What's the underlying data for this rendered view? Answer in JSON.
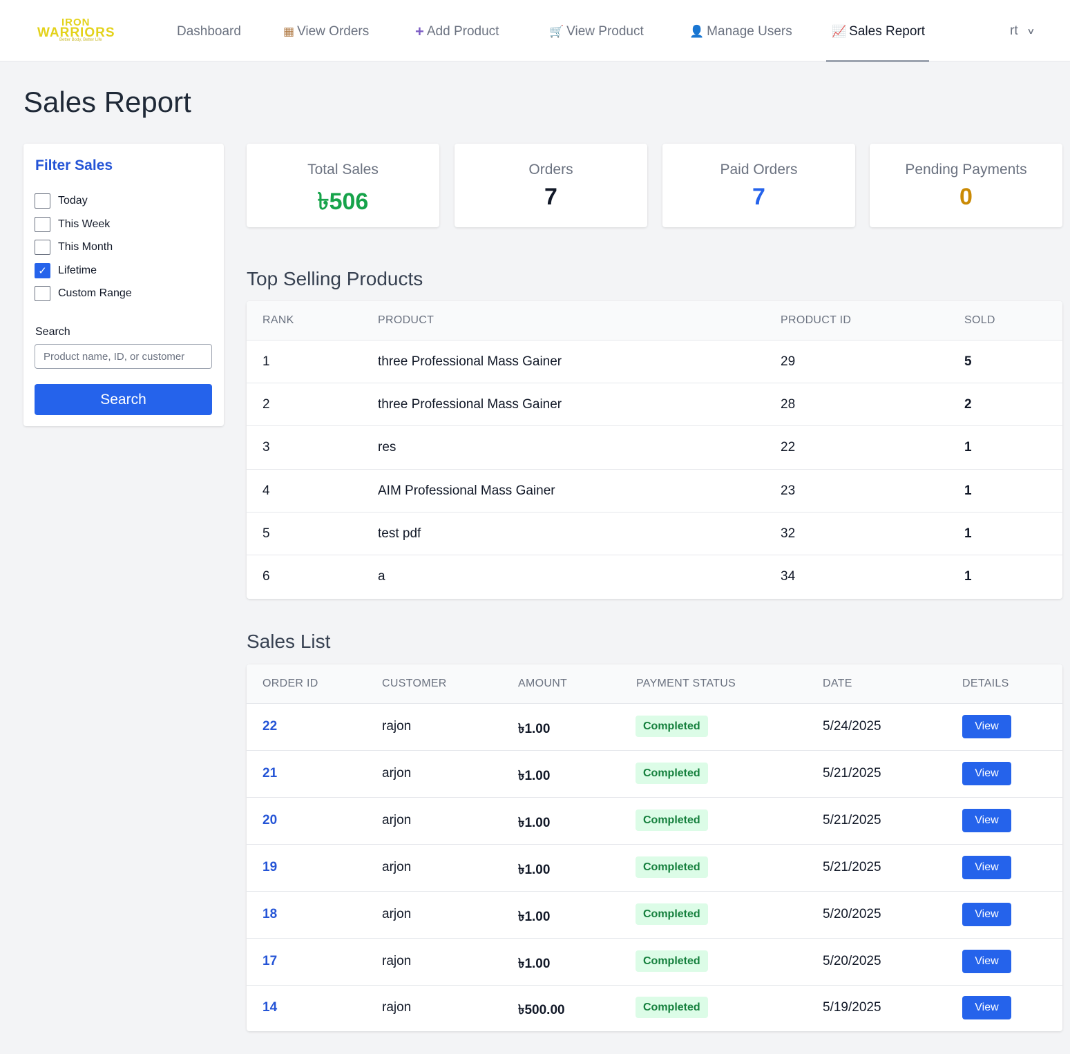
{
  "colors": {
    "accent": "#2563eb",
    "title_blue": "#2454d6",
    "sales_green": "#16a34a",
    "paid_blue": "#2563eb",
    "pending_amber": "#ca8a04",
    "badge_bg": "#dcfce7",
    "badge_text": "#15803d"
  },
  "logo": {
    "line1": "IRON",
    "line2": "WARRIORS",
    "tagline": "Better Body, Better Life"
  },
  "nav": {
    "items": [
      {
        "label": "Dashboard",
        "icon": ""
      },
      {
        "label": "View Orders",
        "icon": "package-icon"
      },
      {
        "label": "Add Product",
        "icon": "plus-icon"
      },
      {
        "label": "View Product",
        "icon": "cart-icon"
      },
      {
        "label": "Manage Users",
        "icon": "user-icon"
      },
      {
        "label": "Sales Report",
        "icon": "chart-icon"
      }
    ],
    "user": "rt"
  },
  "page_title": "Sales Report",
  "filter": {
    "title": "Filter Sales",
    "options": [
      {
        "label": "Today",
        "checked": false
      },
      {
        "label": "This Week",
        "checked": false
      },
      {
        "label": "This Month",
        "checked": false
      },
      {
        "label": "Lifetime",
        "checked": true
      },
      {
        "label": "Custom Range",
        "checked": false
      }
    ],
    "search_label": "Search",
    "search_placeholder": "Product name, ID, or customer",
    "search_button": "Search"
  },
  "stats": [
    {
      "label": "Total Sales",
      "value": "৳506"
    },
    {
      "label": "Orders",
      "value": "7"
    },
    {
      "label": "Paid Orders",
      "value": "7"
    },
    {
      "label": "Pending Payments",
      "value": "0"
    }
  ],
  "top_products": {
    "title": "Top Selling Products",
    "headers": [
      "RANK",
      "PRODUCT",
      "PRODUCT ID",
      "SOLD"
    ],
    "rows": [
      [
        "1",
        "three Professional Mass Gainer",
        "29",
        "5"
      ],
      [
        "2",
        "three Professional Mass Gainer",
        "28",
        "2"
      ],
      [
        "3",
        "res",
        "22",
        "1"
      ],
      [
        "4",
        "AIM Professional Mass Gainer",
        "23",
        "1"
      ],
      [
        "5",
        "test pdf",
        "32",
        "1"
      ],
      [
        "6",
        "a",
        "34",
        "1"
      ]
    ]
  },
  "sales_list": {
    "title": "Sales List",
    "headers": [
      "ORDER ID",
      "CUSTOMER",
      "AMOUNT",
      "PAYMENT STATUS",
      "DATE",
      "DETAILS"
    ],
    "view_label": "View",
    "rows": [
      [
        "22",
        "rajon",
        "৳1.00",
        "Completed",
        "5/24/2025"
      ],
      [
        "21",
        "arjon",
        "৳1.00",
        "Completed",
        "5/21/2025"
      ],
      [
        "20",
        "arjon",
        "৳1.00",
        "Completed",
        "5/21/2025"
      ],
      [
        "19",
        "arjon",
        "৳1.00",
        "Completed",
        "5/21/2025"
      ],
      [
        "18",
        "arjon",
        "৳1.00",
        "Completed",
        "5/20/2025"
      ],
      [
        "17",
        "rajon",
        "৳1.00",
        "Completed",
        "5/20/2025"
      ],
      [
        "14",
        "rajon",
        "৳500.00",
        "Completed",
        "5/19/2025"
      ]
    ]
  }
}
